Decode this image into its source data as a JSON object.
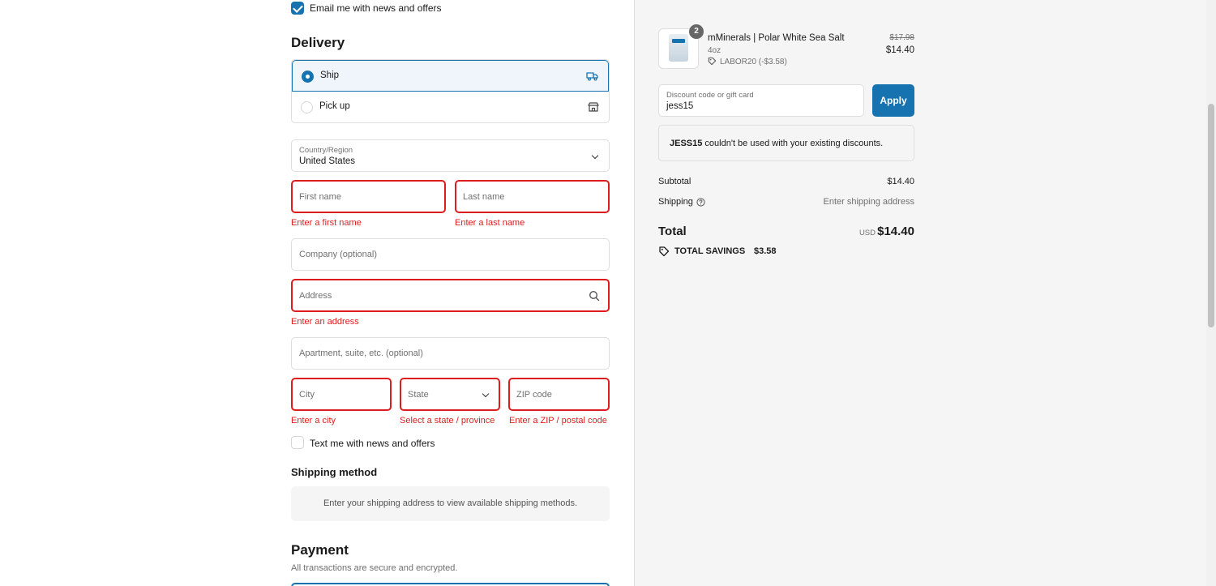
{
  "contact": {
    "email_opt_in_label": "Email me with news and offers",
    "email_opt_in_checked": true
  },
  "delivery": {
    "heading": "Delivery",
    "options": [
      {
        "label": "Ship",
        "selected": true
      },
      {
        "label": "Pick up",
        "selected": false
      }
    ],
    "country": {
      "label": "Country/Region",
      "value": "United States"
    },
    "fields": {
      "first_name": {
        "placeholder": "First name",
        "error": "Enter a first name"
      },
      "last_name": {
        "placeholder": "Last name",
        "error": "Enter a last name"
      },
      "company": {
        "placeholder": "Company (optional)"
      },
      "address": {
        "placeholder": "Address",
        "error": "Enter an address"
      },
      "apartment": {
        "placeholder": "Apartment, suite, etc. (optional)"
      },
      "city": {
        "placeholder": "City",
        "error": "Enter a city"
      },
      "state": {
        "placeholder": "State",
        "error": "Select a state / province"
      },
      "zip": {
        "placeholder": "ZIP code",
        "error": "Enter a ZIP / postal code"
      }
    },
    "sms_opt_in_label": "Text me with news and offers",
    "sms_opt_in_checked": false
  },
  "shipping_method": {
    "heading": "Shipping method",
    "message": "Enter your shipping address to view available shipping methods."
  },
  "payment": {
    "heading": "Payment",
    "subtext": "All transactions are secure and encrypted."
  },
  "summary": {
    "item": {
      "quantity": "2",
      "name": "mMinerals | Polar White Sea Salt",
      "variant": "4oz",
      "discount": "LABOR20 (-$3.58)",
      "original_price": "$17.98",
      "price": "$14.40"
    },
    "discount_field": {
      "label": "Discount code or gift card",
      "value": "jess15"
    },
    "apply_label": "Apply",
    "notice_code": "JESS15",
    "notice_text": " couldn't be used with your existing discounts.",
    "subtotal_label": "Subtotal",
    "subtotal_value": "$14.40",
    "shipping_label": "Shipping",
    "shipping_value": "Enter shipping address",
    "total_label": "Total",
    "currency": "USD",
    "total_value": "$14.40",
    "savings_label": "TOTAL SAVINGS",
    "savings_value": "$3.58"
  },
  "colors": {
    "accent": "#1773b0",
    "error": "#dd1d1d",
    "panel": "#f5f5f5"
  }
}
